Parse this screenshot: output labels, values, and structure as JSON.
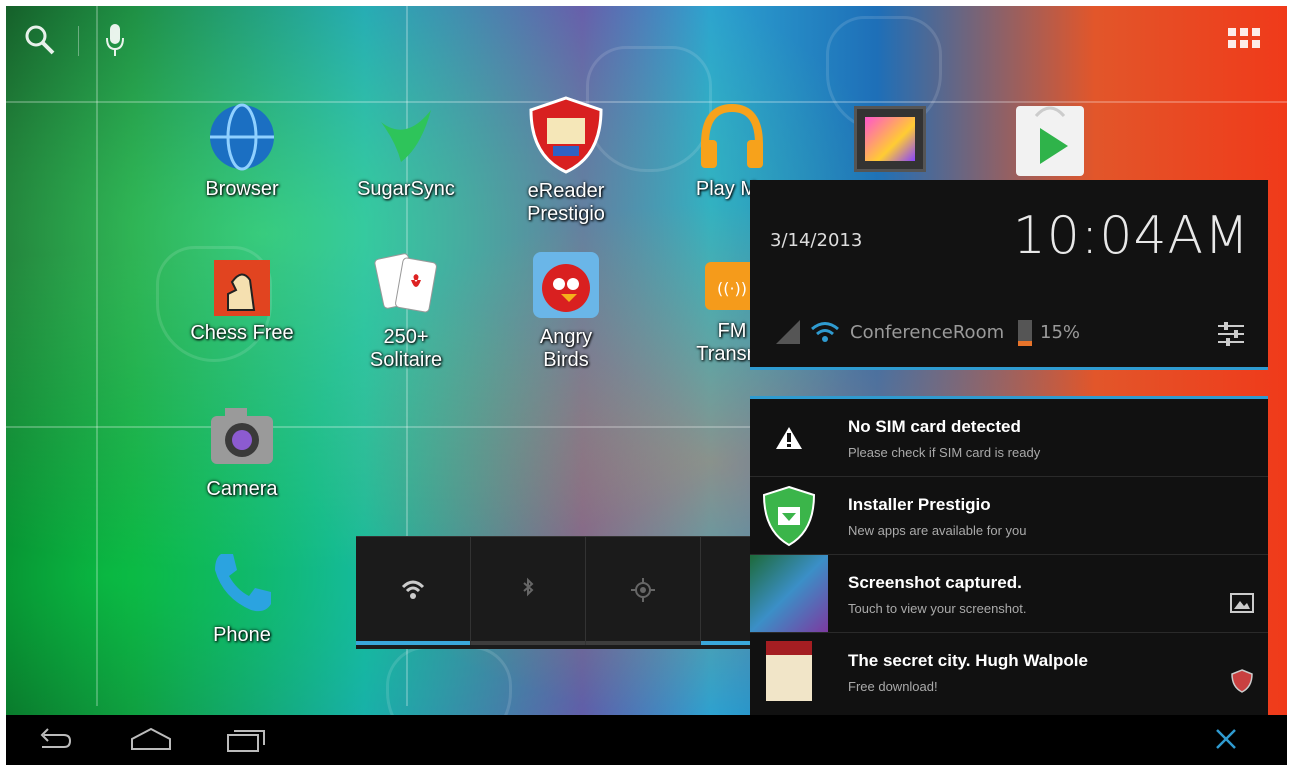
{
  "top_bar": {
    "search_icon": "search-icon",
    "mic_icon": "microphone-icon",
    "all_apps_icon": "all-apps-grid-icon"
  },
  "apps": [
    {
      "label": "Browser",
      "icon": "globe-icon"
    },
    {
      "label": "SugarSync",
      "icon": "hummingbird-icon"
    },
    {
      "label": "eReader\nPrestigio",
      "icon": "ereader-shield-icon"
    },
    {
      "label": "Play Mu",
      "icon": "headphones-icon"
    },
    {
      "label": "Chess Free",
      "icon": "chess-icon"
    },
    {
      "label": "250+\nSolitaire",
      "icon": "playing-cards-icon"
    },
    {
      "label": "Angry\nBirds",
      "icon": "angry-bird-icon"
    },
    {
      "label": "FM\nTransmi",
      "icon": "radio-icon"
    },
    {
      "label": "Camera",
      "icon": "camera-icon"
    },
    {
      "label": "Phone",
      "icon": "phone-icon"
    }
  ],
  "notification_header": {
    "date": "3/14/2013",
    "time": "10:04AM",
    "network_name": "ConferenceRoom",
    "battery_percent": "15%",
    "settings_icon": "settings-sliders-icon"
  },
  "quick_settings": [
    {
      "icon": "wifi-icon",
      "on": true
    },
    {
      "icon": "bluetooth-icon",
      "on": false
    },
    {
      "icon": "gps-icon",
      "on": false
    },
    {
      "icon": "more-icon",
      "on": true
    }
  ],
  "notifications": [
    {
      "title": "No SIM card detected",
      "subtitle": "Please check if SIM card is ready",
      "icon": "warning-icon"
    },
    {
      "title": "Installer Prestigio",
      "subtitle": "New apps are available for you",
      "icon": "installer-shield-icon"
    },
    {
      "title": "Screenshot captured.",
      "subtitle": "Touch to view your screenshot.",
      "icon": "screenshot-thumb-icon"
    },
    {
      "title": "The secret city. Hugh Walpole",
      "subtitle": "Free download!",
      "icon": "book-cover-icon"
    }
  ],
  "nav": {
    "back": "back-icon",
    "home": "home-icon",
    "recents": "recents-icon",
    "clear": "clear-notifications-icon"
  },
  "colors": {
    "accent": "#2f9bd0",
    "panel": "#121212"
  }
}
